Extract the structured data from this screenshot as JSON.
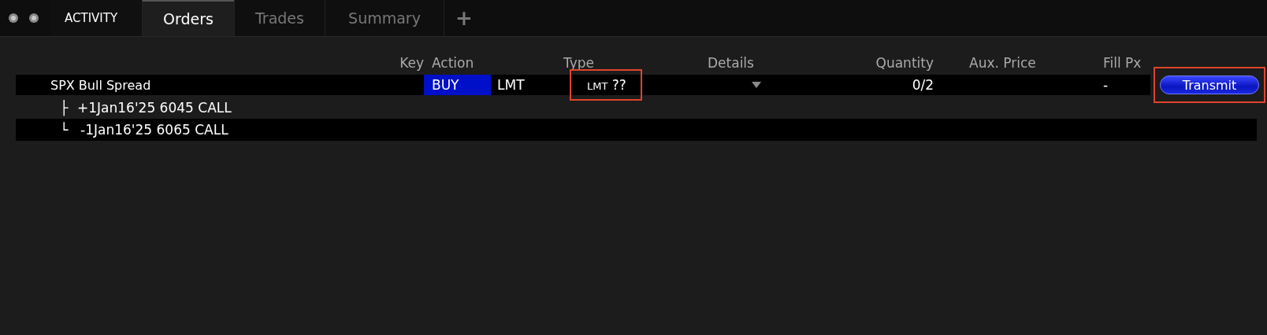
{
  "tabs": [
    {
      "label": "ACTIVITY",
      "selected": false,
      "kind": "section"
    },
    {
      "label": "Orders",
      "selected": true,
      "kind": "tab"
    },
    {
      "label": "Trades",
      "selected": false,
      "kind": "tab"
    },
    {
      "label": "Summary",
      "selected": false,
      "kind": "tab"
    }
  ],
  "add_tab": "+",
  "table": {
    "columns": [
      "Key",
      "Action",
      "Type",
      "Details",
      "Quantity",
      "Aux. Price",
      "Fill Px"
    ],
    "order": {
      "name": "SPX Bull Spread",
      "action": "BUY",
      "type": "LMT",
      "type_detail": {
        "small": "LMT",
        "text": "??",
        "highlighted": true
      },
      "quantity": "0/2",
      "fill_px": "-",
      "transmit": {
        "label": "Transmit",
        "highlighted": true
      }
    },
    "legs": [
      {
        "branch": "├",
        "name": "+1Jan16'25 6045 CALL",
        "striped": false
      },
      {
        "branch": "└",
        "name": "-1Jan16'25 6065 CALL",
        "striped": true
      }
    ]
  }
}
